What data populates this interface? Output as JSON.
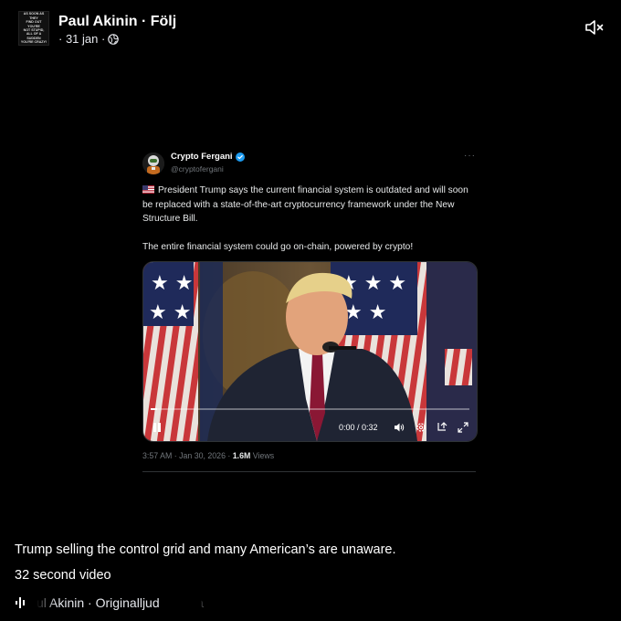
{
  "header": {
    "author_name": "Paul Akinin",
    "separator": " · ",
    "follow_label": "Följ",
    "date": "· 31 jan ·",
    "avatar_lines": [
      "AS SOON AS THEY",
      "FIND OUT YOU'RE",
      "NOT STUPID,",
      "ALL OF A SUDDEN",
      "YOU'RE CRAZY!"
    ],
    "icons": {
      "privacy": "globe-icon",
      "sound": "speaker-muted-icon"
    }
  },
  "tweet": {
    "display_name": "Crypto Fergani",
    "handle": "@cryptofergani",
    "more_label": "···",
    "text_line1": "President Trump says the current financial system is outdated and will soon be replaced with a state-of-the-art cryptocurrency framework under the New Structure Bill.",
    "text_line2": "The entire financial system could go on-chain, powered by crypto!",
    "video": {
      "current_time": "0:00",
      "duration": "0:32",
      "time_display": "0:00 / 0:32",
      "progress_fraction": 0.02,
      "icons": [
        "pause-icon",
        "volume-icon",
        "settings-icon",
        "repost-icon",
        "fullscreen-icon"
      ]
    },
    "timestamp": "3:57 AM · Jan 30, 2026 · ",
    "views_count": "1.6M",
    "views_label": " Views"
  },
  "caption": {
    "text": "Trump selling the control grid and many American’s are unaware.",
    "subtext": "32 second video"
  },
  "audio": {
    "text": "ul Akinin · Originalljud        Pa"
  },
  "colors": {
    "background": "#000000",
    "text_primary": "#ffffff",
    "text_muted": "#71767b",
    "verified": "#1d9bf0"
  }
}
